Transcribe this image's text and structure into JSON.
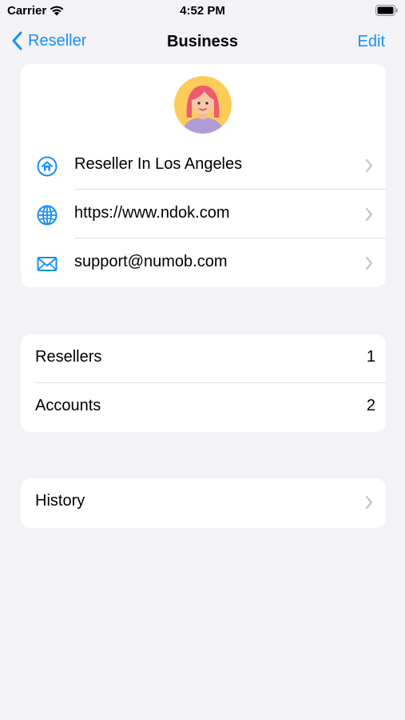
{
  "status_bar": {
    "carrier": "Carrier",
    "time": "4:52 PM"
  },
  "nav": {
    "back_label": "Reseller",
    "title": "Business",
    "edit_label": "Edit"
  },
  "profile": {
    "rows": [
      {
        "icon": "home-icon",
        "label": "Reseller In Los Angeles"
      },
      {
        "icon": "globe-icon",
        "label": "https://www.ndok.com"
      },
      {
        "icon": "mail-icon",
        "label": "support@numob.com"
      }
    ]
  },
  "stats": {
    "rows": [
      {
        "label": "Resellers",
        "value": "1"
      },
      {
        "label": "Accounts",
        "value": "2"
      }
    ]
  },
  "history": {
    "label": "History"
  },
  "colors": {
    "accent": "#1a8ff5",
    "background": "#f2f2f7",
    "card": "#ffffff"
  }
}
